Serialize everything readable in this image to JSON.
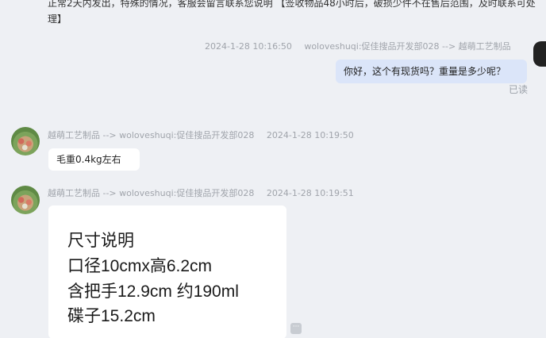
{
  "top_notice": {
    "line1": "正常2天内发出，特殊的情况，客服会留言联系您说明 【签收物品48小时后，破损少件不在售后范围，及时联系可处",
    "line2": "理】"
  },
  "messages": [
    {
      "id": "msg1",
      "sender": "woloveshuqi:促佳搜品开发部028 --> 越萌工艺制品",
      "timestamp": "2024-1-28 10:16:50",
      "text": "你好，这个有现货吗？重量是多少呢？",
      "status": "已读"
    },
    {
      "id": "msg2",
      "sender": "越萌工艺制品 --> woloveshuqi:促佳搜品开发部028",
      "timestamp": "2024-1-28 10:19:50",
      "text": "毛重0.4kg左右"
    },
    {
      "id": "msg3",
      "sender": "越萌工艺制品 --> woloveshuqi:促佳搜品开发部028",
      "timestamp": "2024-1-28 10:19:51",
      "image_lines": [
        "尺寸说明",
        "口径10cmx高6.2cm",
        "含把手12.9cm  约190ml",
        "碟子15.2cm"
      ]
    }
  ],
  "icons": {
    "avatar": "seller-avatar",
    "more": "more-options-icon"
  },
  "colors": {
    "background": "#eef0f4",
    "outgoing_bubble": "#dbe5f9",
    "incoming_bubble": "#ffffff",
    "meta_text": "#a0a4ab"
  }
}
